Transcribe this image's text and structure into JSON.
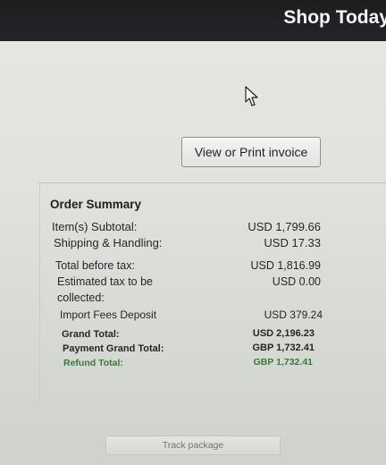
{
  "header": {
    "title": "Shop Today"
  },
  "invoice_button": {
    "label": "View or Print invoice"
  },
  "order_summary": {
    "title": "Order Summary",
    "rows": [
      {
        "label": "Item(s) Subtotal:",
        "value": "USD 1,799.66"
      },
      {
        "label": "Shipping & Handling:",
        "value": "USD 17.33"
      },
      {
        "label": "Total before tax:",
        "value": "USD 1,816.99"
      },
      {
        "label": "Estimated tax to be",
        "value": "USD 0.00"
      },
      {
        "label": "collected:",
        "value": ""
      },
      {
        "label": "Import Fees Deposit",
        "value": "USD 379.24"
      },
      {
        "label": "Grand Total:",
        "value": "USD 2,196.23"
      },
      {
        "label": "Payment Grand Total:",
        "value": "GBP 1,732.41"
      },
      {
        "label": "Refund Total:",
        "value": "GBP 1,732.41"
      }
    ]
  },
  "track_button": {
    "label": "Track package"
  },
  "icons": {
    "cursor": "mouse-pointer-icon"
  },
  "colors": {
    "top_bar": "#1b1d1f",
    "refund_green": "#3b7a3a"
  }
}
